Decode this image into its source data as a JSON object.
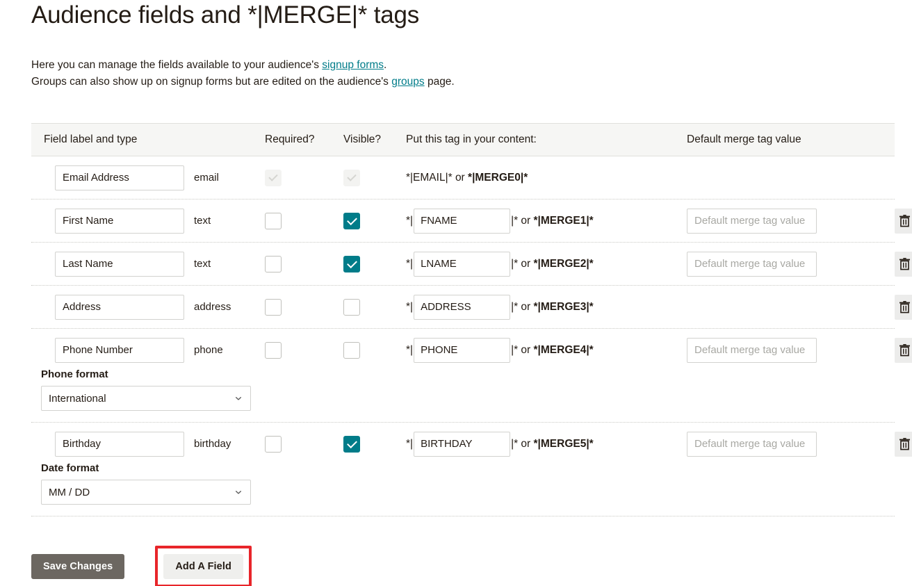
{
  "page": {
    "title": "Audience fields and *|MERGE|* tags",
    "intro": {
      "line1_a": "Here you can manage the fields available to your audience's ",
      "link1": "signup forms",
      "line1_b": ".",
      "line2_a": "Groups can also show up on signup forms but are edited on the audience's ",
      "link2": "groups",
      "line2_b": " page."
    }
  },
  "table": {
    "headers": {
      "label": "Field label and type",
      "required": "Required?",
      "visible": "Visible?",
      "tag": "Put this tag in your content:",
      "default": "Default merge tag value"
    },
    "default_placeholder": "Default merge tag value",
    "tag_prefix": "*|",
    "tag_suffix_or": "|* or ",
    "rows": [
      {
        "label": "Email Address",
        "type": "email",
        "required": true,
        "required_disabled": true,
        "visible": true,
        "visible_disabled": true,
        "tag_editable": false,
        "tag_static": "*|EMAIL|* or ",
        "tag_static_bold": "*|MERGE0|*",
        "tag_value": "EMAIL",
        "merge_alias": "*|MERGE0|*",
        "has_default": false,
        "has_delete": false,
        "default_value": "",
        "subformat": null
      },
      {
        "label": "First Name",
        "type": "text",
        "required": false,
        "required_disabled": false,
        "visible": true,
        "visible_disabled": false,
        "tag_editable": true,
        "tag_value": "FNAME",
        "merge_alias": "*|MERGE1|*",
        "has_default": true,
        "has_delete": true,
        "default_value": "",
        "subformat": null
      },
      {
        "label": "Last Name",
        "type": "text",
        "required": false,
        "required_disabled": false,
        "visible": true,
        "visible_disabled": false,
        "tag_editable": true,
        "tag_value": "LNAME",
        "merge_alias": "*|MERGE2|*",
        "has_default": true,
        "has_delete": true,
        "default_value": "",
        "subformat": null
      },
      {
        "label": "Address",
        "type": "address",
        "required": false,
        "required_disabled": false,
        "visible": false,
        "visible_disabled": false,
        "tag_editable": true,
        "tag_value": "ADDRESS",
        "merge_alias": "*|MERGE3|*",
        "has_default": false,
        "has_delete": true,
        "default_value": "",
        "subformat": null
      },
      {
        "label": "Phone Number",
        "type": "phone",
        "required": false,
        "required_disabled": false,
        "visible": false,
        "visible_disabled": false,
        "tag_editable": true,
        "tag_value": "PHONE",
        "merge_alias": "*|MERGE4|*",
        "has_default": true,
        "has_delete": true,
        "default_value": "",
        "subformat": {
          "label": "Phone format",
          "value": "International"
        }
      },
      {
        "label": "Birthday",
        "type": "birthday",
        "required": false,
        "required_disabled": false,
        "visible": true,
        "visible_disabled": false,
        "tag_editable": true,
        "tag_value": "BIRTHDAY",
        "merge_alias": "*|MERGE5|*",
        "has_default": true,
        "has_delete": true,
        "default_value": "",
        "subformat": {
          "label": "Date format",
          "value": "MM / DD"
        }
      }
    ]
  },
  "actions": {
    "save_label": "Save Changes",
    "add_field_label": "Add A Field"
  },
  "icons": {
    "delete": "trash-icon",
    "chevron": "chevron-down-icon"
  },
  "colors": {
    "accent_teal": "#007c89",
    "highlight_red": "#e8252a",
    "save_button": "#6c6761",
    "header_bg": "#f6f6f4"
  }
}
